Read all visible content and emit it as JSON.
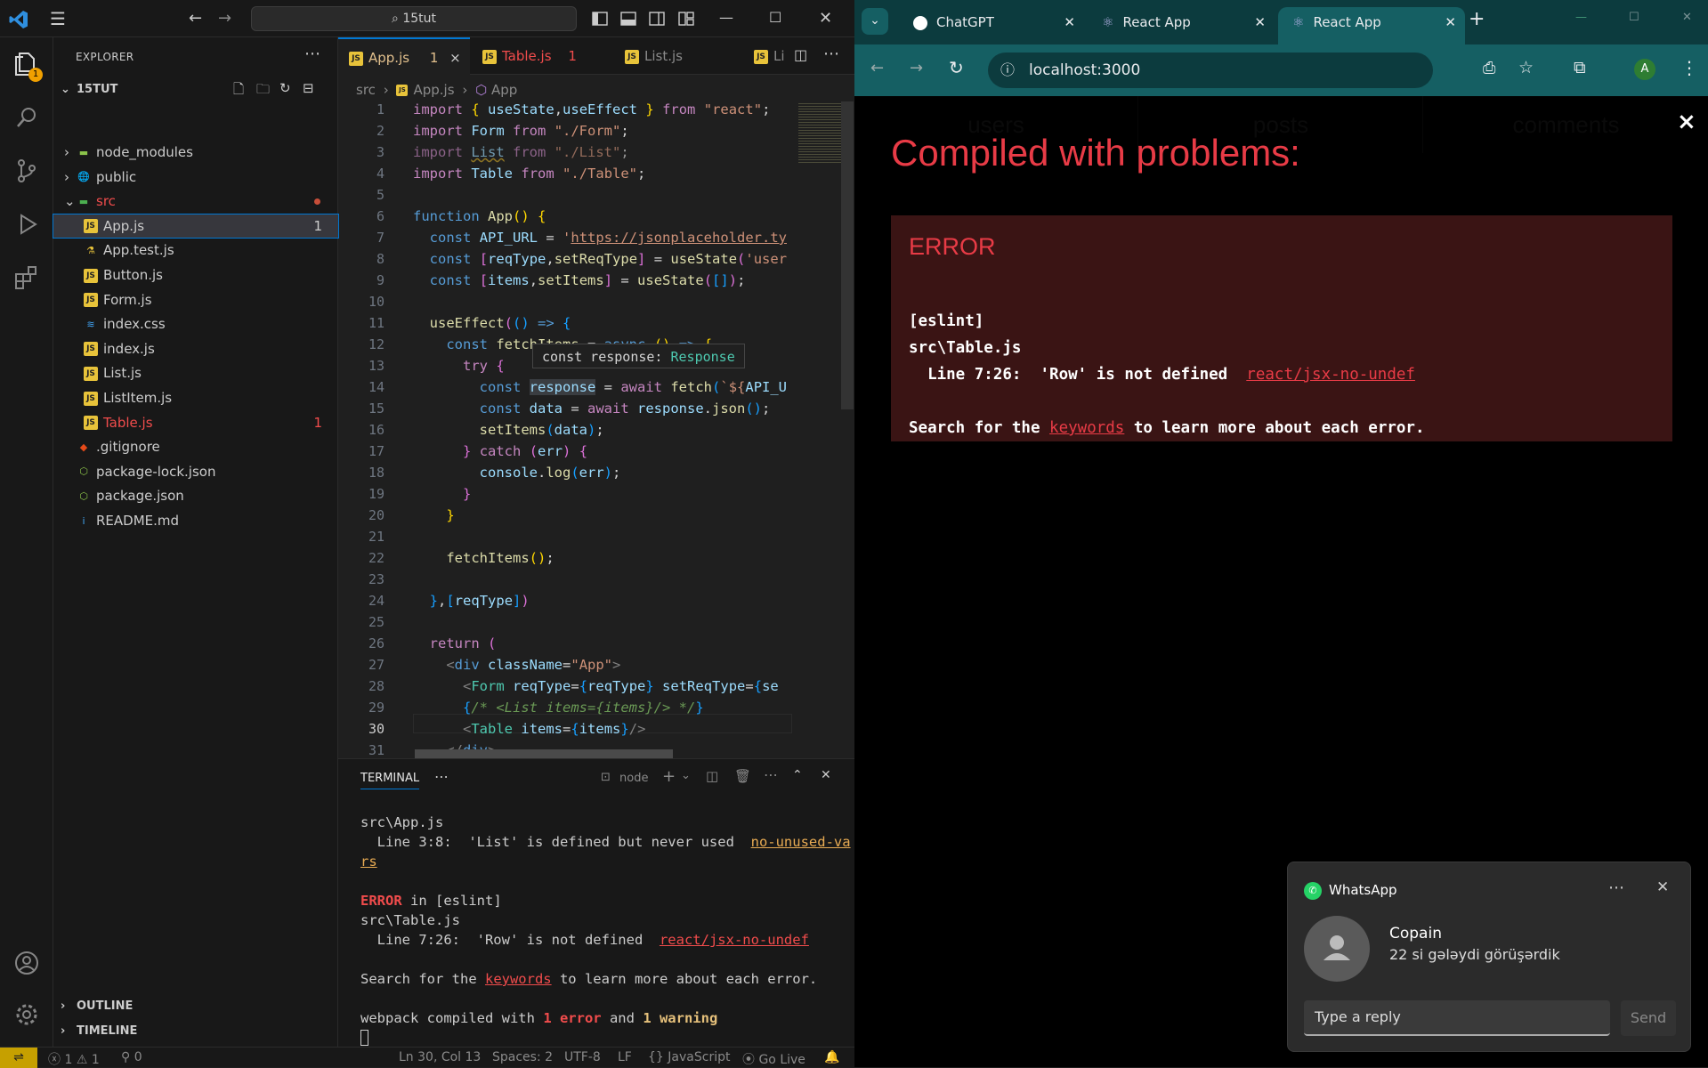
{
  "vscode": {
    "search": "15tut",
    "explorer_title": "EXPLORER",
    "project": "15TUT",
    "badge": "1",
    "tree": [
      {
        "label": "node_modules",
        "type": "folder-node",
        "indent": 1,
        "arrow": "›"
      },
      {
        "label": "public",
        "type": "folder-public",
        "indent": 1,
        "arrow": "›"
      },
      {
        "label": "src",
        "type": "folder-src",
        "indent": 1,
        "arrow": "⌄",
        "color": "#f14c4c"
      },
      {
        "label": "App.js",
        "type": "js",
        "indent": 2,
        "count": "1",
        "selected": true
      },
      {
        "label": "App.test.js",
        "type": "test",
        "indent": 2
      },
      {
        "label": "Button.js",
        "type": "js",
        "indent": 2
      },
      {
        "label": "Form.js",
        "type": "js",
        "indent": 2
      },
      {
        "label": "index.css",
        "type": "css",
        "indent": 2
      },
      {
        "label": "index.js",
        "type": "js",
        "indent": 2
      },
      {
        "label": "List.js",
        "type": "js",
        "indent": 2
      },
      {
        "label": "ListItem.js",
        "type": "js",
        "indent": 2
      },
      {
        "label": "Table.js",
        "type": "js",
        "indent": 2,
        "count": "1",
        "color": "#f14c4c"
      },
      {
        "label": ".gitignore",
        "type": "git",
        "indent": 1
      },
      {
        "label": "package-lock.json",
        "type": "npm",
        "indent": 1
      },
      {
        "label": "package.json",
        "type": "npm",
        "indent": 1
      },
      {
        "label": "README.md",
        "type": "info",
        "indent": 1
      }
    ],
    "outline": "OUTLINE",
    "timeline": "TIMELINE",
    "tabs": [
      {
        "label": "App.js",
        "badge": "1",
        "close": "×"
      },
      {
        "label": "Table.js",
        "badge": "1"
      },
      {
        "label": "List.js"
      },
      {
        "label": "Li"
      }
    ],
    "breadcrumb": {
      "a": "src",
      "sep": "›",
      "b": "App.js",
      "c": "App"
    },
    "hover": {
      "text": "const response: ",
      "type": "Response"
    },
    "terminal": {
      "tab": "TERMINAL",
      "shell": "node",
      "l1": "src\\App.js",
      "l2a": "  Line 3:8:  'List' is defined but never used  ",
      "l2b": "no-unused-va",
      "l3": "rs",
      "l4a": "ERROR",
      "l4b": " in [eslint]",
      "l5": "src\\Table.js",
      "l6a": "  Line 7:26:  'Row' is not defined  ",
      "l6b": "react/jsx-no-undef",
      "l7a": "Search for the ",
      "l7b": "keywords",
      "l7c": " to learn more about each error.",
      "l8a": "webpack compiled with ",
      "l8b": "1 error",
      "l8c": " and ",
      "l8d": "1 warning"
    },
    "status": {
      "errors": "1",
      "warnings": "1",
      "ports": "0",
      "position": "Ln 30, Col 13",
      "spaces": "Spaces: 2",
      "encoding": "UTF-8",
      "eol": "LF",
      "language": "JavaScript",
      "golive": "Go Live"
    }
  },
  "browser": {
    "tabs": [
      {
        "label": "ChatGPT"
      },
      {
        "label": "React App"
      },
      {
        "label": "React App",
        "active": true
      }
    ],
    "url": "localhost:3000",
    "avatar": "A",
    "nav": [
      "users",
      "posts",
      "comments"
    ],
    "overlay_title": "Compiled with problems:",
    "error_label": "ERROR",
    "err1": "[eslint]",
    "err2": "src\\Table.js",
    "err3a": "  Line 7:26:  'Row' is not defined  ",
    "err3b": "react/jsx-no-undef",
    "err4a": "Search for the ",
    "err4b": "keywords",
    "err4c": " to learn more about each error.",
    "close": "×"
  },
  "whatsapp": {
    "app": "WhatsApp",
    "sender": "Copain",
    "message": "22 si gələydi görüşərdik",
    "placeholder": "Type a reply",
    "send": "Send"
  }
}
